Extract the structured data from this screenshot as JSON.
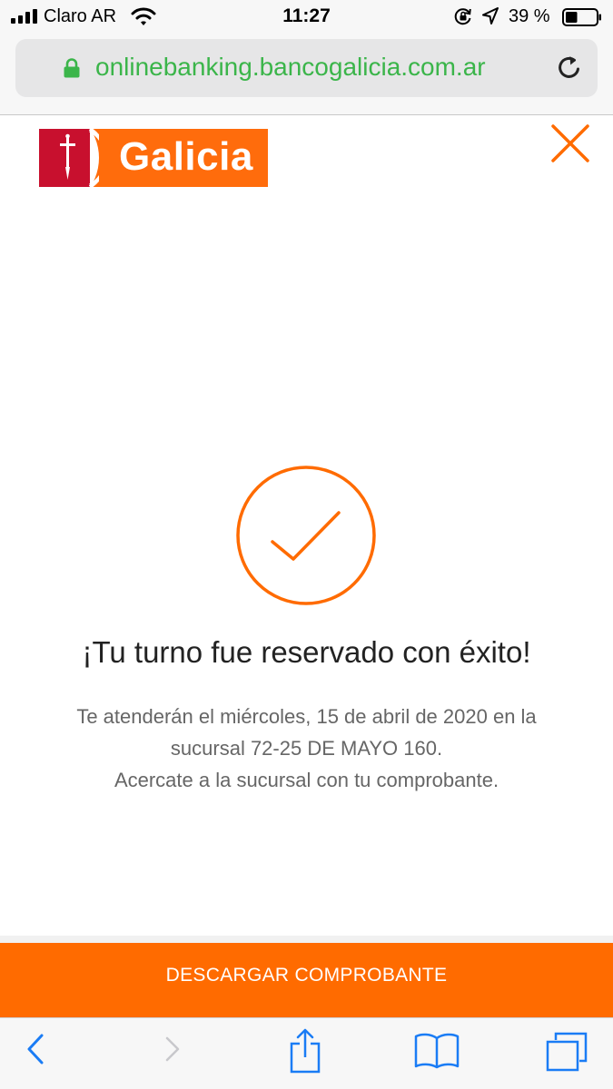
{
  "status_bar": {
    "carrier": "Claro AR",
    "time": "11:27",
    "battery_percent": "39 %",
    "battery_level": 0.39
  },
  "browser": {
    "url": "onlinebanking.bancogalicia.com.ar"
  },
  "header": {
    "logo_text": "Galicia"
  },
  "main": {
    "headline": "¡Tu turno fue reservado con éxito!",
    "message_lines": [
      "Te atenderán el miércoles, 15 de abril de 2020 en la",
      "sucursal 72-25 DE MAYO 160.",
      "Acercate a la sucursal con tu comprobante."
    ],
    "download_label": "DESCARGAR COMPROBANTE"
  },
  "colors": {
    "brand_orange": "#ff6b00",
    "brand_red": "#c8102e",
    "url_green": "#3bb54a",
    "toolbar_blue": "#1a7cf5"
  },
  "icons": {
    "close": "close-icon",
    "success": "checkmark-circle-icon",
    "back": "chevron-left-icon",
    "forward": "chevron-right-icon",
    "share": "share-icon",
    "bookmarks": "book-icon",
    "tabs": "tabs-icon"
  }
}
